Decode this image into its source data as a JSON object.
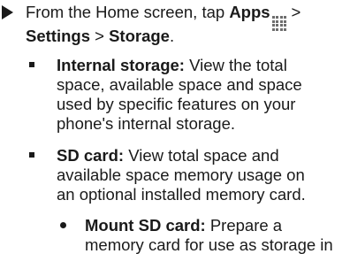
{
  "step": {
    "line1_prefix": "From the Home screen, tap ",
    "apps_label": "Apps",
    "line1_suffix": " >",
    "settings_label": "Settings",
    "separator": " > ",
    "storage_label": "Storage",
    "end": "."
  },
  "bullets": [
    {
      "title": "Internal storage:",
      "lines": [
        " View the total",
        "space, available space and space",
        "used by specific features on your",
        "phone's internal storage."
      ]
    },
    {
      "title": "SD card:",
      "lines": [
        " View total space and",
        "available space memory usage on",
        "an optional installed memory card."
      ]
    }
  ],
  "sub_bullets": [
    {
      "title": "Mount SD card:",
      "lines": [
        " Prepare a",
        "memory card for use as storage in"
      ]
    }
  ],
  "icons": {
    "step_marker": "right-arrow-icon",
    "apps": "apps-grid-icon",
    "bullet": "square-bullet-icon",
    "sub_bullet": "round-bullet-icon"
  }
}
